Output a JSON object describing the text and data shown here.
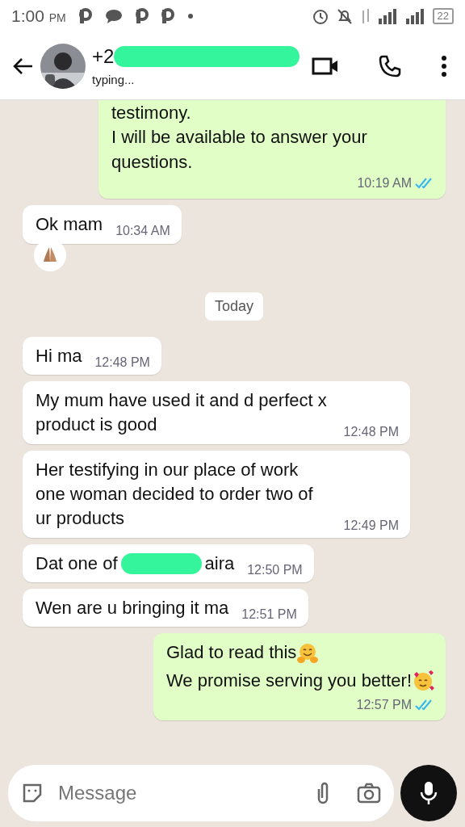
{
  "status_bar": {
    "time": "1:00",
    "ampm": "PM",
    "battery": "22"
  },
  "header": {
    "contact_parts": [
      "+2"
    ],
    "contact_redacted": true,
    "status": "typing..."
  },
  "messages": [
    {
      "kind": "message",
      "outgoing": true,
      "lines": [
        "testimony.",
        "I will be available to answer your questions."
      ],
      "time": "10:19 AM",
      "read": true,
      "cut_top": true
    },
    {
      "kind": "message",
      "outgoing": false,
      "lines": [
        "Ok mam"
      ],
      "time": "10:34 AM",
      "reaction": {
        "kind": "pray"
      }
    },
    {
      "kind": "date",
      "label": "Today"
    },
    {
      "kind": "message",
      "outgoing": false,
      "lines": [
        "Hi ma"
      ],
      "time": "12:48 PM"
    },
    {
      "kind": "message",
      "outgoing": false,
      "lines": [
        "My mum have used it and d perfect x product is good"
      ],
      "time": "12:48 PM"
    },
    {
      "kind": "message",
      "outgoing": false,
      "lines": [
        "Her testifying in our place of work one  woman decided to order two of ur products"
      ],
      "time": "12:49 PM"
    },
    {
      "kind": "message",
      "outgoing": false,
      "parts": [
        "Dat one of",
        "aira"
      ],
      "time": "12:50 PM"
    },
    {
      "kind": "message",
      "outgoing": false,
      "lines": [
        "Wen are u bringing it ma"
      ],
      "time": "12:51 PM"
    },
    {
      "kind": "message",
      "outgoing": true,
      "emoji_lines": [
        {
          "text": "Glad to read this",
          "kind": "hug"
        },
        {
          "text": "We promise serving you better!",
          "kind": "hearts"
        }
      ],
      "time": "12:57 PM",
      "read": true
    }
  ],
  "composer": {
    "placeholder": "Message"
  }
}
